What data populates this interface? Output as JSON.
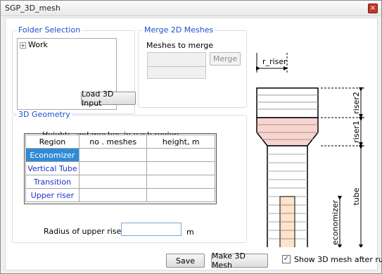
{
  "window": {
    "title": "SGP_3D_mesh",
    "close_glyph": "×"
  },
  "folder_selection": {
    "legend": "Folder Selection",
    "tree": [
      {
        "expander": "+",
        "label": "Work"
      }
    ],
    "load_button": "Load 3D Input"
  },
  "merge_2d": {
    "legend": "Merge 2D Meshes",
    "meshes_label": "Meshes to merge",
    "merge_button": "Merge"
  },
  "geometry": {
    "legend": "3D Geometry",
    "heights_label": "Heights and meshes in each region",
    "columns": [
      "Region",
      "no . meshes",
      "height, m"
    ],
    "rows": [
      {
        "region": "Economizer",
        "meshes": "",
        "height": ""
      },
      {
        "region": "Vertical Tube",
        "meshes": "",
        "height": ""
      },
      {
        "region": "Transition",
        "meshes": "",
        "height": ""
      },
      {
        "region": "Upper riser",
        "meshes": "",
        "height": ""
      }
    ],
    "radius_label": "Radius of upper riser",
    "radius_value": "",
    "radius_unit": "m"
  },
  "footer": {
    "save_button": "Save",
    "make_button": "Make 3D Mesh",
    "show_checkbox_label": "Show 3D mesh after run",
    "show_checked": true
  },
  "diagram": {
    "r_riser_label": "r_riser",
    "riser2_label": "riser2",
    "riser1_label": "riser1",
    "tube_label": "tube",
    "economizer_label": "economizer"
  },
  "colors": {
    "accent": "#1c4fd1",
    "selected_row": "#2f8bd6",
    "transition_fill": "#f6d4cf",
    "economizer_fill": "#fbe3cd"
  }
}
